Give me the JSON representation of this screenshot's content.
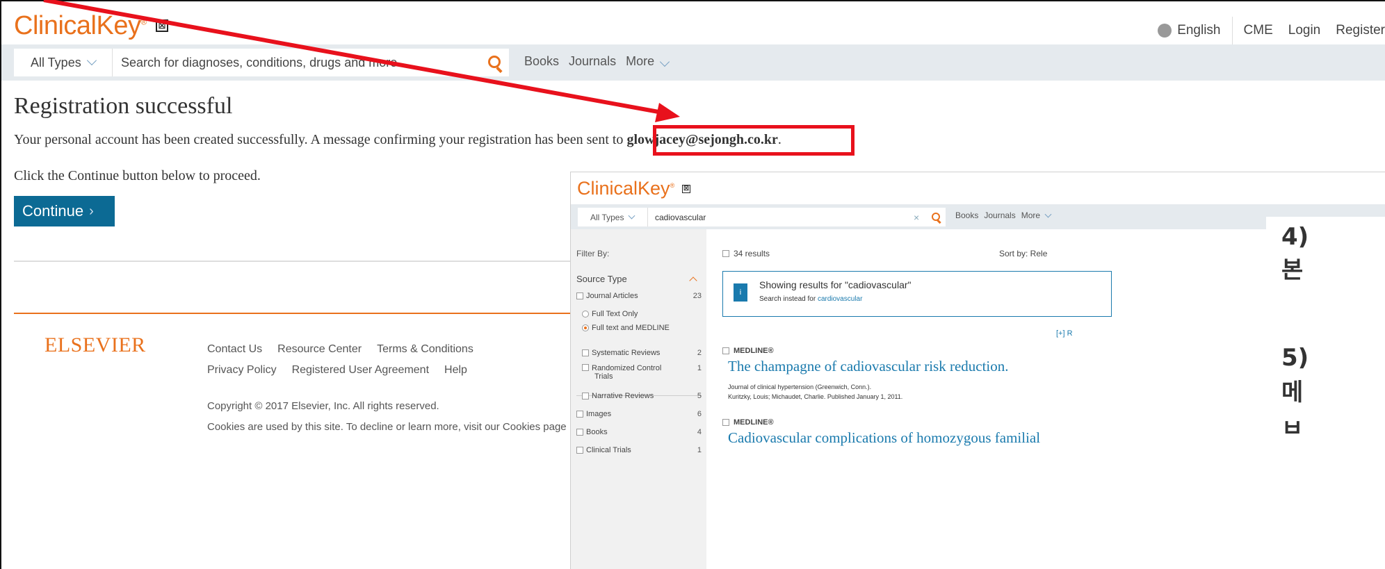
{
  "header": {
    "logo": "ClinicalKey",
    "logo_mark": "®",
    "close_glyph": "☒",
    "language": "English",
    "nav": [
      "CME",
      "Login",
      "Register"
    ]
  },
  "search": {
    "type_label": "All Types",
    "placeholder": "Search for diagnoses, conditions, drugs and more...",
    "links": [
      "Books",
      "Journals",
      "More"
    ]
  },
  "main": {
    "title": "Registration successful",
    "message_prefix": "Your personal account has been created successfully. A message confirming your registration has been sent to ",
    "email": "glowjacey@sejongh.co.kr",
    "message_suffix": ".",
    "continue_prompt": "Click the Continue button below to proceed.",
    "continue_label": "Continue",
    "continue_chevron": "›"
  },
  "footer": {
    "brand": "ELSEVIER",
    "links_row1": [
      "Contact Us",
      "Resource Center",
      "Terms & Conditions"
    ],
    "links_row2": [
      "Privacy Policy",
      "Registered User Agreement",
      "Help"
    ],
    "copyright": "Copyright © 2017 Elsevier, Inc. All rights reserved.",
    "cookies": "Cookies are used by this site. To decline or learn more, visit our Cookies page"
  },
  "inset": {
    "logo": "ClinicalKey",
    "logo_mark": "®",
    "close_glyph": "☒",
    "type_label": "All Types",
    "query": "cadiovascular",
    "clear_glyph": "×",
    "links": [
      "Books",
      "Journals",
      "More"
    ],
    "filter_by": "Filter By:",
    "source_type": "Source Type",
    "filters": [
      {
        "label": "Journal Articles",
        "count": "23"
      },
      {
        "label": "Full Text Only",
        "count": ""
      },
      {
        "label": "Full text and MEDLINE",
        "count": ""
      },
      {
        "label": "Systematic Reviews",
        "count": "2"
      },
      {
        "label": "Randomized Control",
        "label2": "Trials",
        "count": "1"
      },
      {
        "label": "Narrative Reviews",
        "count": "5"
      },
      {
        "label": "Images",
        "count": "6"
      },
      {
        "label": "Books",
        "count": "4"
      },
      {
        "label": "Clinical Trials",
        "count": "1"
      }
    ],
    "results_count": "34 results",
    "sort_label": "Sort by: Rele",
    "info_icon": "i",
    "showing": "Showing results for  \"cadiovascular\"",
    "instead_prefix": "Search instead for ",
    "instead_link": "cardiovascular",
    "expand": "[+] R",
    "results": [
      {
        "source": "MEDLINE®",
        "title": "The champagne of cadiovascular risk reduction.",
        "journal": "Journal of clinical hypertension (Greenwich, Conn.).",
        "authors": "Kuritzky, Louis; Michaudet, Charlie. Published January 1, 2011."
      },
      {
        "source": "MEDLINE®",
        "title": "Cadiovascular complications of homozygous familial",
        "journal": "",
        "authors": ""
      }
    ]
  },
  "korean_notes": [
    "4)",
    "본",
    "5)",
    "메",
    "ㅂ"
  ],
  "colors": {
    "brand_orange": "#e9711c",
    "link_blue": "#1a7aad",
    "button_blue": "#0c6a94",
    "annotation_red": "#e8111c",
    "search_bg": "#e5eaee"
  }
}
